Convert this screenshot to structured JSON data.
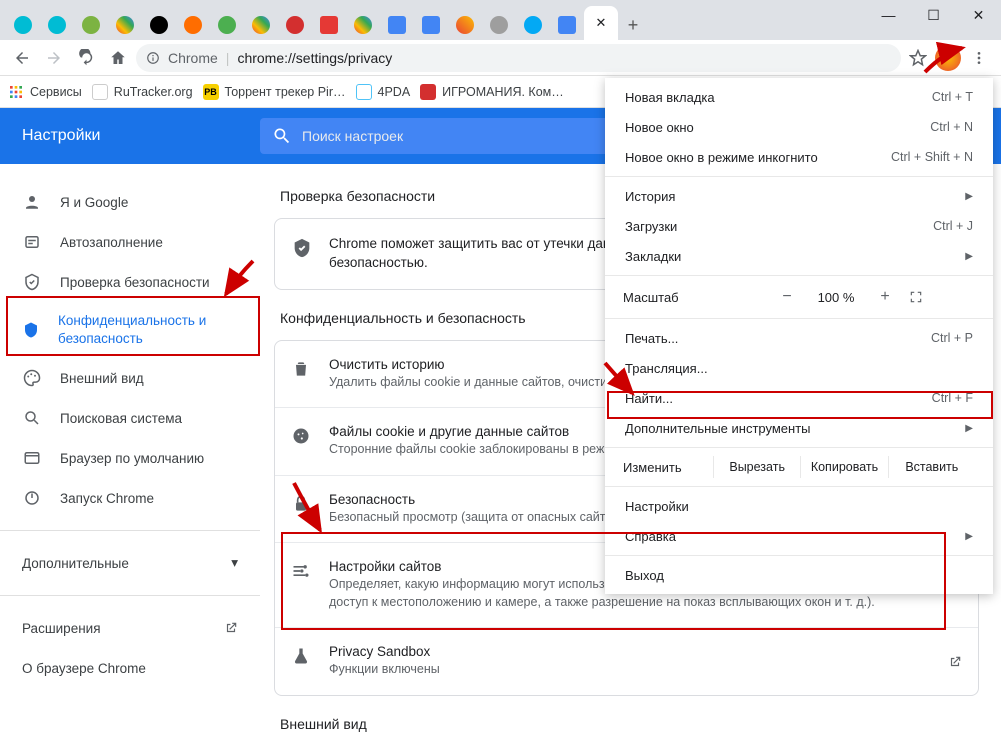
{
  "window": {
    "minimize": "—",
    "maximize": "☐",
    "close": "✕"
  },
  "tabs": {
    "close_active": "✕",
    "new": "+"
  },
  "toolbar": {
    "secure_label": "Chrome",
    "url": "chrome://settings/privacy"
  },
  "bookmarks": {
    "apps": "Сервисы",
    "items": [
      {
        "label": "RuTracker.org",
        "color": "#fff"
      },
      {
        "label": "Торрент трекер Pir…",
        "color": "#f7d000"
      },
      {
        "label": "4PDA",
        "color": "#e3f2ff"
      },
      {
        "label": "ИГРОМАНИЯ. Ком…",
        "color": "#fff"
      }
    ]
  },
  "settings_header": {
    "title": "Настройки",
    "search_placeholder": "Поиск настроек"
  },
  "sidebar": {
    "items": [
      {
        "label": "Я и Google"
      },
      {
        "label": "Автозаполнение"
      },
      {
        "label": "Проверка безопасности"
      },
      {
        "label": "Конфиденциальность и безопасность"
      },
      {
        "label": "Внешний вид"
      },
      {
        "label": "Поисковая система"
      },
      {
        "label": "Браузер по умолчанию"
      },
      {
        "label": "Запуск Chrome"
      }
    ],
    "advanced": "Дополнительные",
    "extensions": "Расширения",
    "about": "О браузере Chrome"
  },
  "content": {
    "section1_title": "Проверка безопасности",
    "safety_text": "Chrome поможет защитить вас от утечки данных, небезопасных расширений и других проблем с безопасностью.",
    "section2_title": "Конфиденциальность и безопасность",
    "rows": [
      {
        "title": "Очистить историю",
        "sub": "Удалить файлы cookie и данные сайтов, очистить историю и кеш"
      },
      {
        "title": "Файлы cookie и другие данные сайтов",
        "sub": "Сторонние файлы cookie заблокированы в режиме инкогнито"
      },
      {
        "title": "Безопасность",
        "sub": "Безопасный просмотр (защита от опасных сайтов) и другие настройки безопасности"
      },
      {
        "title": "Настройки сайтов",
        "sub": "Определяет, какую информацию могут использовать и показывать сайты (например, есть ли у них доступ к местоположению и камере, а также разрешение на показ всплывающих окон и т. д.)."
      },
      {
        "title": "Privacy Sandbox",
        "sub": "Функции включены"
      }
    ],
    "section3_title": "Внешний вид"
  },
  "menu": {
    "new_tab": "Новая вкладка",
    "new_tab_sc": "Ctrl + T",
    "new_window": "Новое окно",
    "new_window_sc": "Ctrl + N",
    "incognito": "Новое окно в режиме инкогнито",
    "incognito_sc": "Ctrl + Shift + N",
    "history": "История",
    "downloads": "Загрузки",
    "downloads_sc": "Ctrl + J",
    "bookmarks": "Закладки",
    "zoom_label": "Масштаб",
    "zoom_minus": "−",
    "zoom_value": "100 %",
    "zoom_plus": "+",
    "print": "Печать...",
    "print_sc": "Ctrl + P",
    "cast": "Трансляция...",
    "find": "Найти...",
    "find_sc": "Ctrl + F",
    "more_tools": "Дополнительные инструменты",
    "edit_label": "Изменить",
    "cut": "Вырезать",
    "copy": "Копировать",
    "paste": "Вставить",
    "settings": "Настройки",
    "help": "Справка",
    "exit": "Выход"
  }
}
